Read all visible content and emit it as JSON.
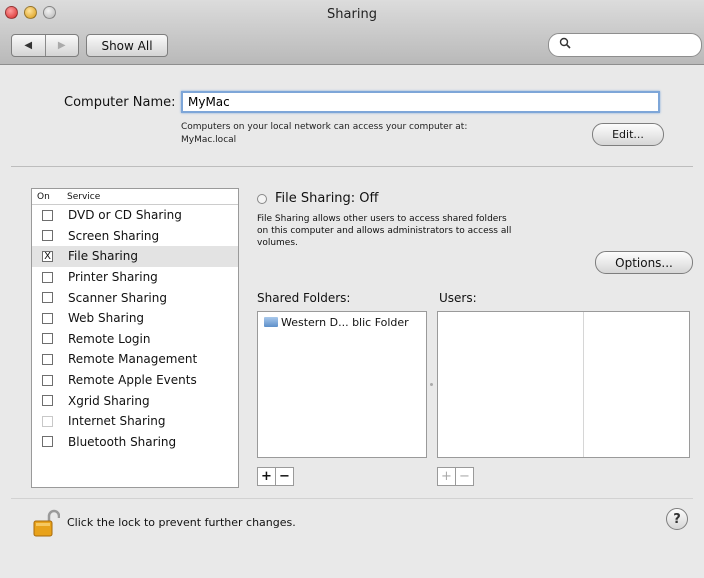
{
  "window": {
    "title": "Sharing"
  },
  "toolbar": {
    "back_icon": "◀",
    "forward_icon": "▶",
    "show_all_label": "Show All",
    "search_icon": "🔍",
    "search_placeholder": ""
  },
  "computer_name": {
    "label": "Computer Name:",
    "value": "MyMac",
    "note_line1": "Computers on your local network can access your computer at:",
    "note_line2": "MyMac.local",
    "edit_label": "Edit..."
  },
  "services": {
    "header_on": "On",
    "header_service": "Service",
    "items": [
      {
        "label": "DVD or CD Sharing",
        "mark": "",
        "selected": false
      },
      {
        "label": "Screen Sharing",
        "mark": "",
        "selected": false
      },
      {
        "label": "File Sharing",
        "mark": "X",
        "selected": true
      },
      {
        "label": "Printer Sharing",
        "mark": "",
        "selected": false
      },
      {
        "label": "Scanner Sharing",
        "mark": "",
        "selected": false
      },
      {
        "label": "Web Sharing",
        "mark": "",
        "selected": false
      },
      {
        "label": "Remote Login",
        "mark": "",
        "selected": false
      },
      {
        "label": "Remote Management",
        "mark": "",
        "selected": false
      },
      {
        "label": "Remote Apple Events",
        "mark": "",
        "selected": false
      },
      {
        "label": "Xgrid Sharing",
        "mark": "",
        "selected": false
      },
      {
        "label": "Internet Sharing",
        "mark": "",
        "selected": false
      },
      {
        "label": "Bluetooth Sharing",
        "mark": "",
        "selected": false
      }
    ]
  },
  "file_sharing": {
    "status": "File Sharing: Off",
    "description_line1": "File Sharing allows other users to access shared folders",
    "description_line2": "on this computer and allows administrators to access all",
    "description_line3": "volumes.",
    "options_label": "Options...",
    "shared_folders_label": "Shared Folders:",
    "users_label": "Users:",
    "shared_folders": [
      "Western D... blic Folder"
    ],
    "add_label": "+",
    "remove_label": "−"
  },
  "footer": {
    "lock_text": "Click the lock to prevent further changes.",
    "help_label": "?"
  },
  "colors": {
    "focus_ring": "#7ea6d8",
    "lock": "#e8a21a"
  }
}
